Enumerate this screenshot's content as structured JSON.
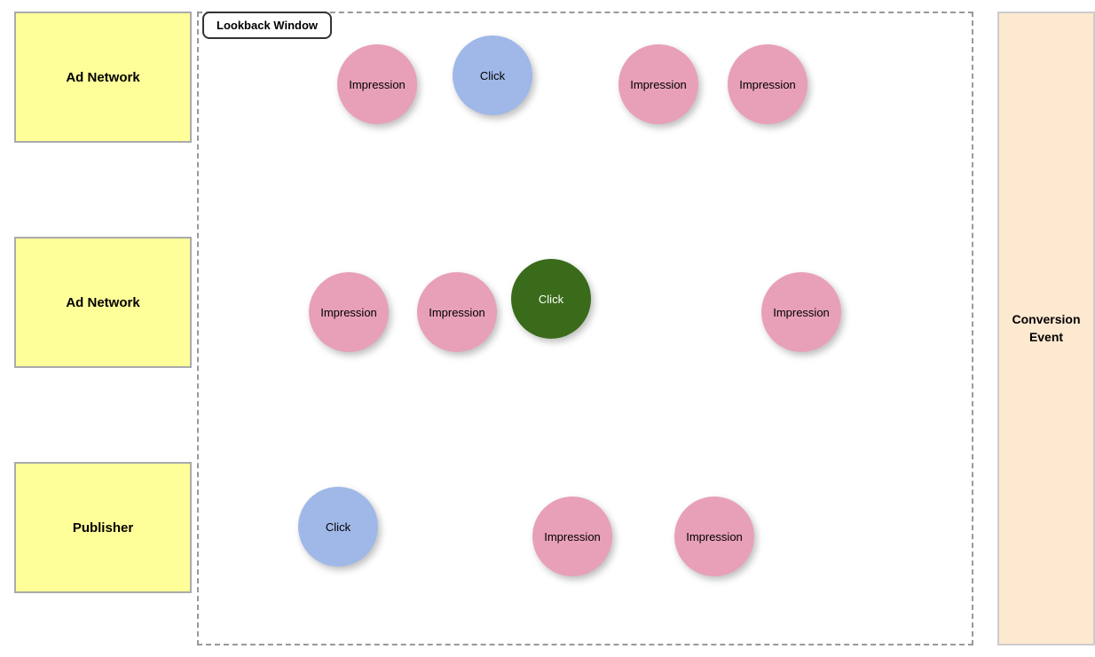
{
  "labels": {
    "ad_network_1": "Ad Network",
    "ad_network_2": "Ad Network",
    "publisher": "Publisher",
    "lookback_window": "Lookback Window",
    "conversion_event": "Conversion Event"
  },
  "circles": [
    {
      "id": "c1",
      "type": "pink",
      "label": "Impression"
    },
    {
      "id": "c2",
      "type": "blue",
      "label": "Click"
    },
    {
      "id": "c3",
      "type": "pink",
      "label": "Impression"
    },
    {
      "id": "c4",
      "type": "pink",
      "label": "Impression"
    },
    {
      "id": "c5",
      "type": "pink",
      "label": "Impression"
    },
    {
      "id": "c6",
      "type": "pink",
      "label": "Impression"
    },
    {
      "id": "c7",
      "type": "green",
      "label": "Click"
    },
    {
      "id": "c8",
      "type": "pink",
      "label": "Impression"
    },
    {
      "id": "c9",
      "type": "blue",
      "label": "Click"
    },
    {
      "id": "c10",
      "type": "pink",
      "label": "Impression"
    },
    {
      "id": "c11",
      "type": "pink",
      "label": "Impression"
    }
  ]
}
